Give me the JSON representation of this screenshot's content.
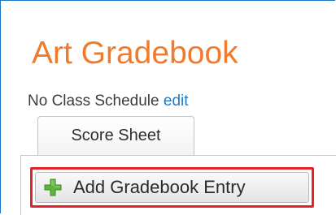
{
  "page": {
    "title": "Art Gradebook",
    "schedule_text": "No Class Schedule",
    "schedule_edit_label": "edit"
  },
  "tabs": [
    {
      "label": "Score Sheet",
      "active": true
    }
  ],
  "toolbar": {
    "add_entry_label": "Add Gradebook Entry",
    "add_entry_icon": "plus-icon"
  },
  "colors": {
    "title": "#f07b2c",
    "link": "#1f78c8",
    "frame_border": "#1e78c6",
    "highlight_border": "#e2242a",
    "plus_icon_green": "#5db53d"
  }
}
